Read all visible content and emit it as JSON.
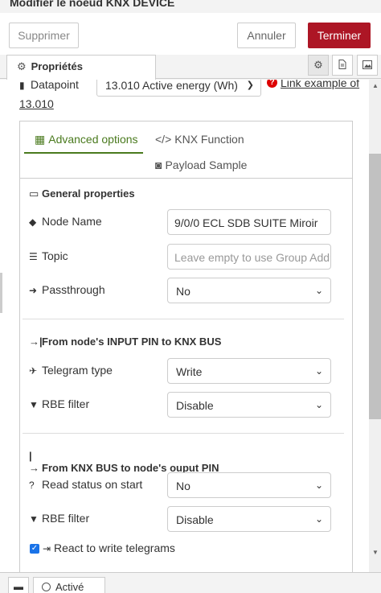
{
  "window": {
    "title": "Modifier le noeud KNX DEVICE"
  },
  "toolbar": {
    "delete_label": "Supprimer",
    "cancel_label": "Annuler",
    "done_label": "Terminer"
  },
  "tabs": {
    "properties_label": "Propriétés"
  },
  "datapoint": {
    "label": "Datapoint",
    "selected": "13.010 Active energy (Wh)",
    "link_text_1": "Link example of",
    "link_text_2": "13.010",
    "warning_glyph": "?"
  },
  "inner_tabs": {
    "advanced": "Advanced options",
    "knx_function": "KNX Function",
    "payload_sample": "Payload Sample"
  },
  "general": {
    "title": "General properties",
    "node_name_label": "Node Name",
    "node_name_value": "9/0/0 ECL SDB SUITE Miroir",
    "topic_label": "Topic",
    "topic_placeholder": "Leave empty to use Group Address",
    "passthrough_label": "Passthrough",
    "passthrough_value": "No"
  },
  "input_pin": {
    "title": "From node's INPUT PIN to KNX BUS",
    "telegram_label": "Telegram type",
    "telegram_value": "Write",
    "rbe_label": "RBE filter",
    "rbe_value": "Disable"
  },
  "output_pin": {
    "title": "From KNX BUS to node's ouput PIN",
    "read_status_label": "Read status on start",
    "read_status_value": "No",
    "rbe_label": "RBE filter",
    "rbe_value": "Disable",
    "react_label": "React to write telegrams",
    "react_checked": true
  },
  "footer": {
    "status_label": "Activé"
  },
  "colors": {
    "accent_red": "#ad1625",
    "tab_green": "#4a7a1e",
    "checkbox_blue": "#1a73e8"
  }
}
